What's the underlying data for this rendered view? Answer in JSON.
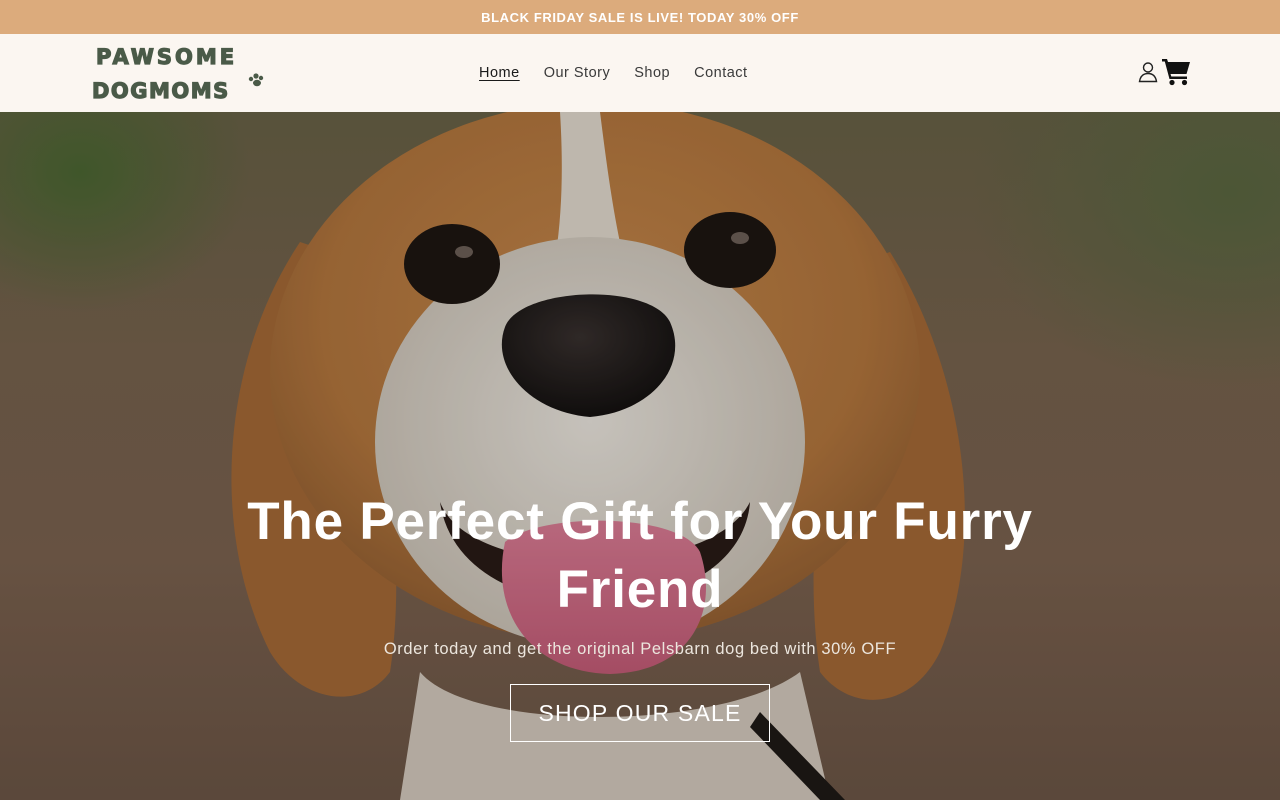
{
  "announcement": {
    "text": "BLACK FRIDAY SALE IS LIVE! TODAY 30% OFF"
  },
  "header": {
    "logo": {
      "line1": "PAWSOME",
      "line2": "DOGMOMS"
    },
    "nav": [
      {
        "label": "Home",
        "active": true
      },
      {
        "label": "Our Story",
        "active": false
      },
      {
        "label": "Shop",
        "active": false
      },
      {
        "label": "Contact",
        "active": false
      }
    ],
    "icons": {
      "account": "account-icon",
      "cart": "cart-icon"
    }
  },
  "hero": {
    "image": "beagle-dog-photo",
    "title": "The Perfect Gift for Your Furry Friend",
    "subtitle": "Order today and get the original Pelsbarn dog bed with 30% OFF",
    "cta_label": "SHOP OUR SALE"
  },
  "colors": {
    "announcement_bg": "#dcab7c",
    "header_bg": "#fbf6f1",
    "logo_color": "#4a5a48",
    "nav_text": "#3a3a3a"
  }
}
